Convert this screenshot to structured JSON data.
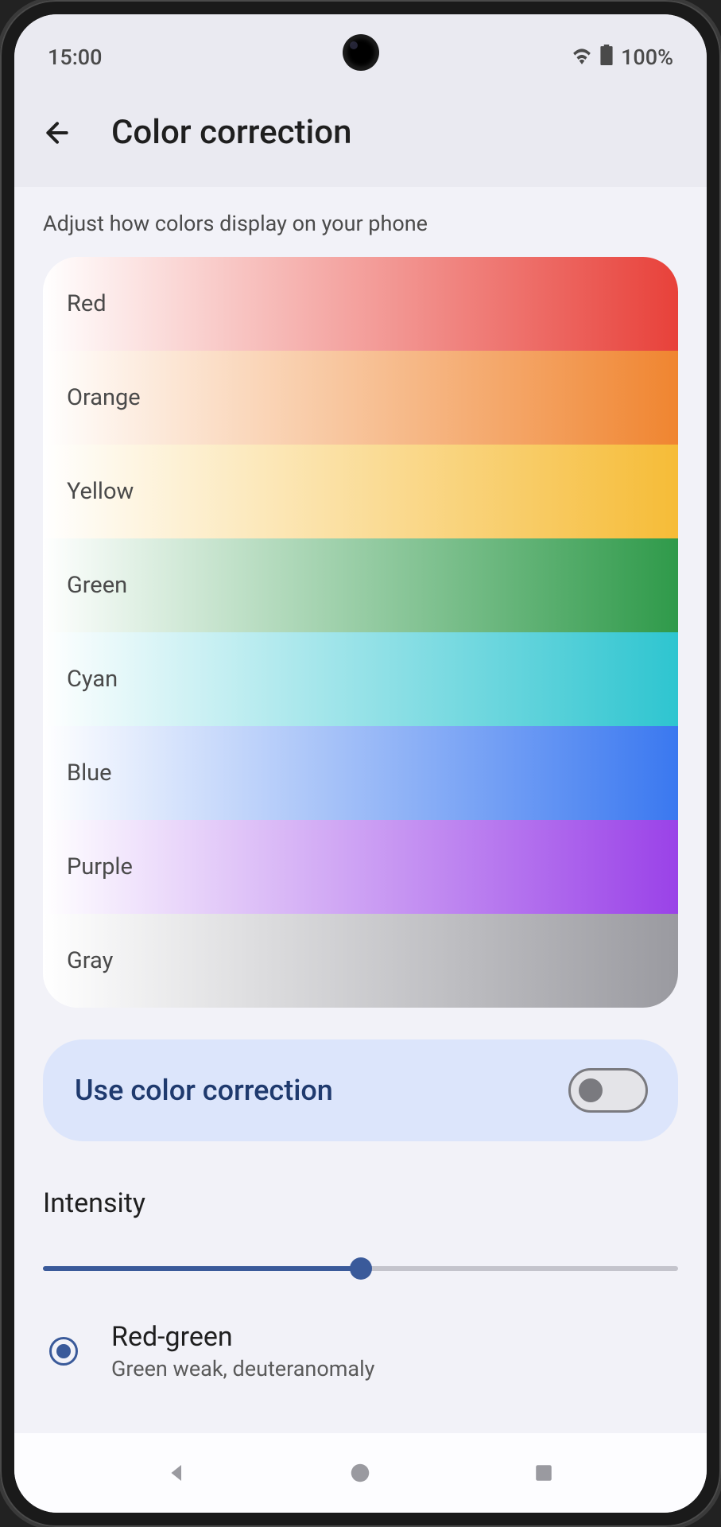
{
  "status": {
    "time": "15:00",
    "battery": "100%"
  },
  "header": {
    "title": "Color correction"
  },
  "subtitle": "Adjust how colors display on your phone",
  "colors": [
    {
      "label": "Red",
      "hex": "#e8413a"
    },
    {
      "label": "Orange",
      "hex": "#f08530"
    },
    {
      "label": "Yellow",
      "hex": "#f6bc37"
    },
    {
      "label": "Green",
      "hex": "#2f9a4a"
    },
    {
      "label": "Cyan",
      "hex": "#2ec5d0"
    },
    {
      "label": "Blue",
      "hex": "#3a78f0"
    },
    {
      "label": "Purple",
      "hex": "#9a42e8"
    },
    {
      "label": "Gray",
      "hex": "#9a9aa0"
    }
  ],
  "toggle": {
    "label": "Use color correction",
    "value": false
  },
  "intensity": {
    "label": "Intensity",
    "value": 50
  },
  "option": {
    "title": "Red-green",
    "subtitle": "Green weak, deuteranomaly",
    "selected": true
  }
}
